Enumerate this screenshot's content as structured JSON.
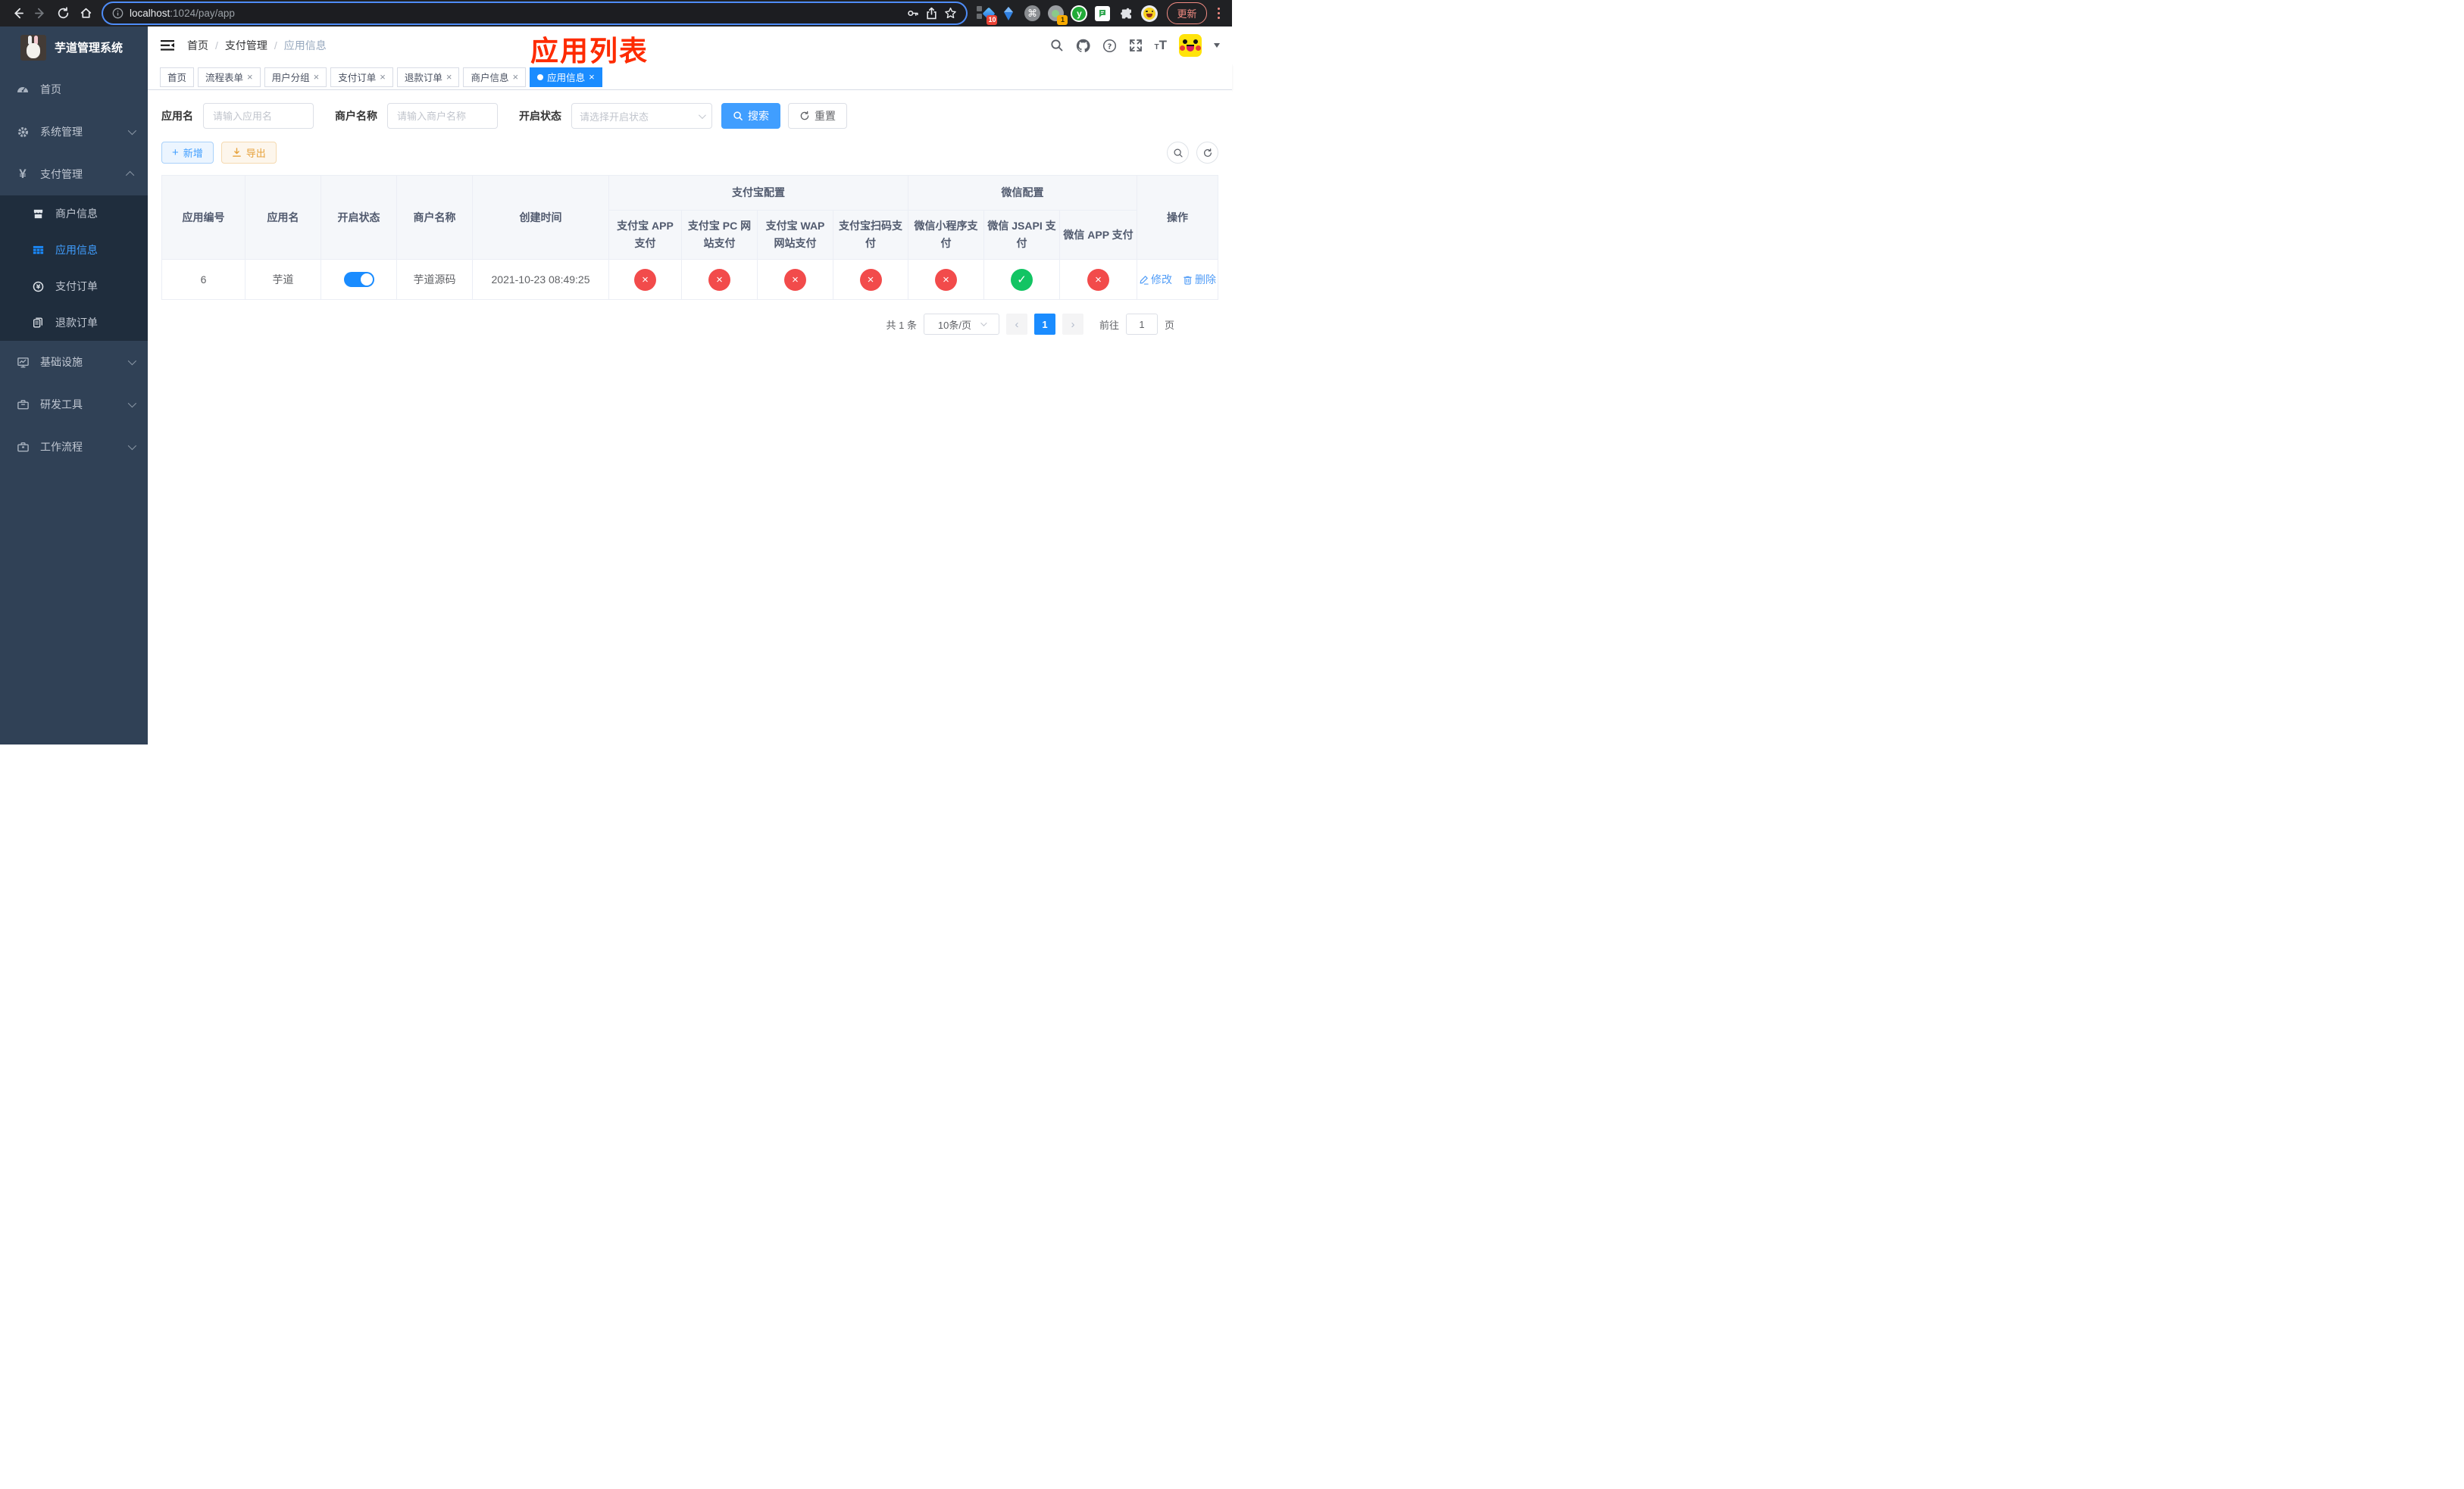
{
  "browser": {
    "url": {
      "host": "localhost",
      "path": ":1024/pay/app"
    },
    "update_label": "更新",
    "extensions": {
      "badge_blocks": "10",
      "badge_tracker": "1",
      "y_ext_label": "y"
    }
  },
  "glyphs": {
    "check": "✓",
    "cross": "×",
    "close": "×",
    "dot": "●",
    "sep": "/",
    "prev": "‹",
    "next": "›",
    "command": "⌘",
    "star": "☆",
    "plus": "+"
  },
  "sidebar": {
    "title": "芋道管理系统",
    "items": [
      {
        "label": "首页"
      },
      {
        "label": "系统管理",
        "expandable": true
      },
      {
        "label": "支付管理",
        "expandable": true,
        "expanded": true,
        "children": [
          {
            "label": "商户信息"
          },
          {
            "label": "应用信息",
            "active": true
          },
          {
            "label": "支付订单"
          },
          {
            "label": "退款订单"
          }
        ]
      },
      {
        "label": "基础设施",
        "expandable": true
      },
      {
        "label": "研发工具",
        "expandable": true
      },
      {
        "label": "工作流程",
        "expandable": true
      }
    ]
  },
  "navbar": {
    "breadcrumb": [
      "首页",
      "支付管理",
      "应用信息"
    ],
    "annotation": "应用列表"
  },
  "tabs": [
    {
      "label": "首页",
      "closable": false,
      "active": false
    },
    {
      "label": "流程表单",
      "closable": true,
      "active": false
    },
    {
      "label": "用户分组",
      "closable": true,
      "active": false
    },
    {
      "label": "支付订单",
      "closable": true,
      "active": false
    },
    {
      "label": "退款订单",
      "closable": true,
      "active": false
    },
    {
      "label": "商户信息",
      "closable": true,
      "active": false
    },
    {
      "label": "应用信息",
      "closable": true,
      "active": true
    }
  ],
  "filters": {
    "app_name": {
      "label": "应用名",
      "placeholder": "请输入应用名",
      "value": ""
    },
    "merchant_name": {
      "label": "商户名称",
      "placeholder": "请输入商户名称",
      "value": ""
    },
    "status": {
      "label": "开启状态",
      "placeholder": "请选择开启状态",
      "value": ""
    },
    "search_label": "搜索",
    "reset_label": "重置"
  },
  "toolbar": {
    "add_label": "新增",
    "export_label": "导出"
  },
  "table": {
    "columns": [
      "应用编号",
      "应用名",
      "开启状态",
      "商户名称",
      "创建时间"
    ],
    "groups": [
      {
        "label": "支付宝配置",
        "children": [
          "支付宝 APP 支付",
          "支付宝 PC 网站支付",
          "支付宝 WAP 网站支付",
          "支付宝扫码支付"
        ]
      },
      {
        "label": "微信配置",
        "children": [
          "微信小程序支付",
          "微信 JSAPI 支付",
          "微信 APP 支付"
        ]
      }
    ],
    "op_column": "操作",
    "rows": [
      {
        "id": "6",
        "app_name": "芋道",
        "enabled": true,
        "merchant_name": "芋道源码",
        "create_time": "2021-10-23 08:49:25",
        "channel_enabled": [
          false,
          false,
          false,
          false,
          false,
          true,
          false
        ],
        "edit_label": "修改",
        "delete_label": "删除"
      }
    ]
  },
  "pagination": {
    "total_label": "共 1 条",
    "page_size_label": "10条/页",
    "current_page": "1",
    "goto_label": "前往",
    "goto_value": "1",
    "unit_label": "页"
  }
}
